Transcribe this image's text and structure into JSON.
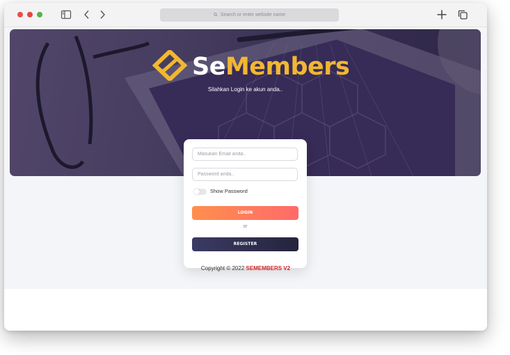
{
  "browser": {
    "address_placeholder": "Search or enter website name",
    "icons": [
      "sidebar-icon",
      "back-icon",
      "forward-icon",
      "search-icon",
      "new-tab-icon",
      "tabs-overview-icon"
    ]
  },
  "brand": {
    "part1": "Se",
    "part2": "Members",
    "subtitle": "Silahkan Login ke akun anda..",
    "accent": "#f2b731"
  },
  "login": {
    "email_placeholder": "Masukan Email anda..",
    "password_placeholder": "Password anda..",
    "show_password_label": "Show Password",
    "login_button": "LOGIN",
    "or_text": "or",
    "register_button": "REGISTER"
  },
  "footer": {
    "copyright": "Copyright © 2022 ",
    "brand": "SEMEMBERS V2"
  }
}
